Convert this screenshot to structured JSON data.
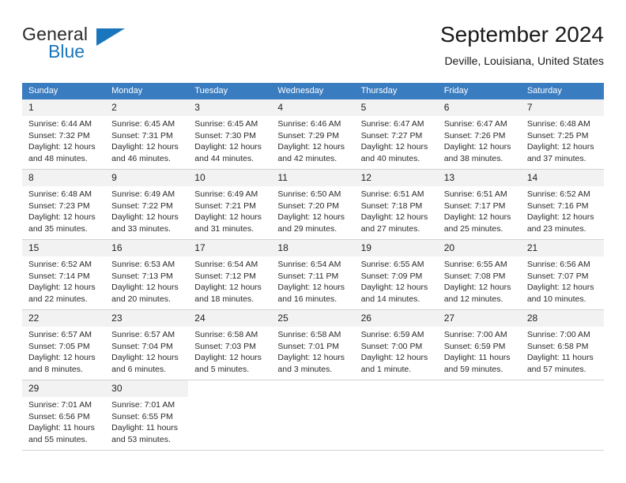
{
  "brand": {
    "name_top": "General",
    "name_bottom": "Blue",
    "triangle_color": "#1a76bc",
    "top_color": "#2b2b2b"
  },
  "header": {
    "title": "September 2024",
    "subtitle": "Deville, Louisiana, United States"
  },
  "calendar": {
    "header_bg": "#3a7cc0",
    "daynum_bg": "#f2f2f2",
    "weekdays": [
      "Sunday",
      "Monday",
      "Tuesday",
      "Wednesday",
      "Thursday",
      "Friday",
      "Saturday"
    ],
    "weeks": [
      [
        {
          "num": "1",
          "sunrise": "Sunrise: 6:44 AM",
          "sunset": "Sunset: 7:32 PM",
          "daylight1": "Daylight: 12 hours",
          "daylight2": "and 48 minutes."
        },
        {
          "num": "2",
          "sunrise": "Sunrise: 6:45 AM",
          "sunset": "Sunset: 7:31 PM",
          "daylight1": "Daylight: 12 hours",
          "daylight2": "and 46 minutes."
        },
        {
          "num": "3",
          "sunrise": "Sunrise: 6:45 AM",
          "sunset": "Sunset: 7:30 PM",
          "daylight1": "Daylight: 12 hours",
          "daylight2": "and 44 minutes."
        },
        {
          "num": "4",
          "sunrise": "Sunrise: 6:46 AM",
          "sunset": "Sunset: 7:29 PM",
          "daylight1": "Daylight: 12 hours",
          "daylight2": "and 42 minutes."
        },
        {
          "num": "5",
          "sunrise": "Sunrise: 6:47 AM",
          "sunset": "Sunset: 7:27 PM",
          "daylight1": "Daylight: 12 hours",
          "daylight2": "and 40 minutes."
        },
        {
          "num": "6",
          "sunrise": "Sunrise: 6:47 AM",
          "sunset": "Sunset: 7:26 PM",
          "daylight1": "Daylight: 12 hours",
          "daylight2": "and 38 minutes."
        },
        {
          "num": "7",
          "sunrise": "Sunrise: 6:48 AM",
          "sunset": "Sunset: 7:25 PM",
          "daylight1": "Daylight: 12 hours",
          "daylight2": "and 37 minutes."
        }
      ],
      [
        {
          "num": "8",
          "sunrise": "Sunrise: 6:48 AM",
          "sunset": "Sunset: 7:23 PM",
          "daylight1": "Daylight: 12 hours",
          "daylight2": "and 35 minutes."
        },
        {
          "num": "9",
          "sunrise": "Sunrise: 6:49 AM",
          "sunset": "Sunset: 7:22 PM",
          "daylight1": "Daylight: 12 hours",
          "daylight2": "and 33 minutes."
        },
        {
          "num": "10",
          "sunrise": "Sunrise: 6:49 AM",
          "sunset": "Sunset: 7:21 PM",
          "daylight1": "Daylight: 12 hours",
          "daylight2": "and 31 minutes."
        },
        {
          "num": "11",
          "sunrise": "Sunrise: 6:50 AM",
          "sunset": "Sunset: 7:20 PM",
          "daylight1": "Daylight: 12 hours",
          "daylight2": "and 29 minutes."
        },
        {
          "num": "12",
          "sunrise": "Sunrise: 6:51 AM",
          "sunset": "Sunset: 7:18 PM",
          "daylight1": "Daylight: 12 hours",
          "daylight2": "and 27 minutes."
        },
        {
          "num": "13",
          "sunrise": "Sunrise: 6:51 AM",
          "sunset": "Sunset: 7:17 PM",
          "daylight1": "Daylight: 12 hours",
          "daylight2": "and 25 minutes."
        },
        {
          "num": "14",
          "sunrise": "Sunrise: 6:52 AM",
          "sunset": "Sunset: 7:16 PM",
          "daylight1": "Daylight: 12 hours",
          "daylight2": "and 23 minutes."
        }
      ],
      [
        {
          "num": "15",
          "sunrise": "Sunrise: 6:52 AM",
          "sunset": "Sunset: 7:14 PM",
          "daylight1": "Daylight: 12 hours",
          "daylight2": "and 22 minutes."
        },
        {
          "num": "16",
          "sunrise": "Sunrise: 6:53 AM",
          "sunset": "Sunset: 7:13 PM",
          "daylight1": "Daylight: 12 hours",
          "daylight2": "and 20 minutes."
        },
        {
          "num": "17",
          "sunrise": "Sunrise: 6:54 AM",
          "sunset": "Sunset: 7:12 PM",
          "daylight1": "Daylight: 12 hours",
          "daylight2": "and 18 minutes."
        },
        {
          "num": "18",
          "sunrise": "Sunrise: 6:54 AM",
          "sunset": "Sunset: 7:11 PM",
          "daylight1": "Daylight: 12 hours",
          "daylight2": "and 16 minutes."
        },
        {
          "num": "19",
          "sunrise": "Sunrise: 6:55 AM",
          "sunset": "Sunset: 7:09 PM",
          "daylight1": "Daylight: 12 hours",
          "daylight2": "and 14 minutes."
        },
        {
          "num": "20",
          "sunrise": "Sunrise: 6:55 AM",
          "sunset": "Sunset: 7:08 PM",
          "daylight1": "Daylight: 12 hours",
          "daylight2": "and 12 minutes."
        },
        {
          "num": "21",
          "sunrise": "Sunrise: 6:56 AM",
          "sunset": "Sunset: 7:07 PM",
          "daylight1": "Daylight: 12 hours",
          "daylight2": "and 10 minutes."
        }
      ],
      [
        {
          "num": "22",
          "sunrise": "Sunrise: 6:57 AM",
          "sunset": "Sunset: 7:05 PM",
          "daylight1": "Daylight: 12 hours",
          "daylight2": "and 8 minutes."
        },
        {
          "num": "23",
          "sunrise": "Sunrise: 6:57 AM",
          "sunset": "Sunset: 7:04 PM",
          "daylight1": "Daylight: 12 hours",
          "daylight2": "and 6 minutes."
        },
        {
          "num": "24",
          "sunrise": "Sunrise: 6:58 AM",
          "sunset": "Sunset: 7:03 PM",
          "daylight1": "Daylight: 12 hours",
          "daylight2": "and 5 minutes."
        },
        {
          "num": "25",
          "sunrise": "Sunrise: 6:58 AM",
          "sunset": "Sunset: 7:01 PM",
          "daylight1": "Daylight: 12 hours",
          "daylight2": "and 3 minutes."
        },
        {
          "num": "26",
          "sunrise": "Sunrise: 6:59 AM",
          "sunset": "Sunset: 7:00 PM",
          "daylight1": "Daylight: 12 hours",
          "daylight2": "and 1 minute."
        },
        {
          "num": "27",
          "sunrise": "Sunrise: 7:00 AM",
          "sunset": "Sunset: 6:59 PM",
          "daylight1": "Daylight: 11 hours",
          "daylight2": "and 59 minutes."
        },
        {
          "num": "28",
          "sunrise": "Sunrise: 7:00 AM",
          "sunset": "Sunset: 6:58 PM",
          "daylight1": "Daylight: 11 hours",
          "daylight2": "and 57 minutes."
        }
      ],
      [
        {
          "num": "29",
          "sunrise": "Sunrise: 7:01 AM",
          "sunset": "Sunset: 6:56 PM",
          "daylight1": "Daylight: 11 hours",
          "daylight2": "and 55 minutes."
        },
        {
          "num": "30",
          "sunrise": "Sunrise: 7:01 AM",
          "sunset": "Sunset: 6:55 PM",
          "daylight1": "Daylight: 11 hours",
          "daylight2": "and 53 minutes."
        },
        {
          "num": "",
          "sunrise": "",
          "sunset": "",
          "daylight1": "",
          "daylight2": ""
        },
        {
          "num": "",
          "sunrise": "",
          "sunset": "",
          "daylight1": "",
          "daylight2": ""
        },
        {
          "num": "",
          "sunrise": "",
          "sunset": "",
          "daylight1": "",
          "daylight2": ""
        },
        {
          "num": "",
          "sunrise": "",
          "sunset": "",
          "daylight1": "",
          "daylight2": ""
        },
        {
          "num": "",
          "sunrise": "",
          "sunset": "",
          "daylight1": "",
          "daylight2": ""
        }
      ]
    ]
  }
}
